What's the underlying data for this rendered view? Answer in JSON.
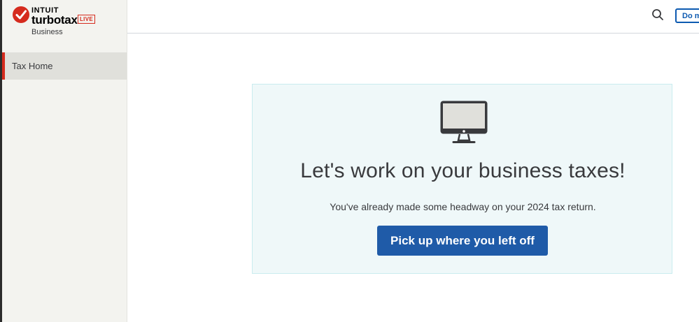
{
  "brand": {
    "company": "INTUIT",
    "product": "turbotax",
    "badge": "LIVE",
    "subtitle": "Business",
    "accent_color": "#d52b1e"
  },
  "sidebar": {
    "items": [
      {
        "label": "Tax Home",
        "active": true
      }
    ]
  },
  "header": {
    "search_icon": "search-icon",
    "button_label": "Do m"
  },
  "main": {
    "card": {
      "icon": "monitor-icon",
      "title": "Let's work on your business taxes!",
      "subtitle": "You've already made some headway on your 2024 tax return.",
      "button_label": "Pick up where you left off",
      "button_color": "#1f5ba8"
    }
  }
}
